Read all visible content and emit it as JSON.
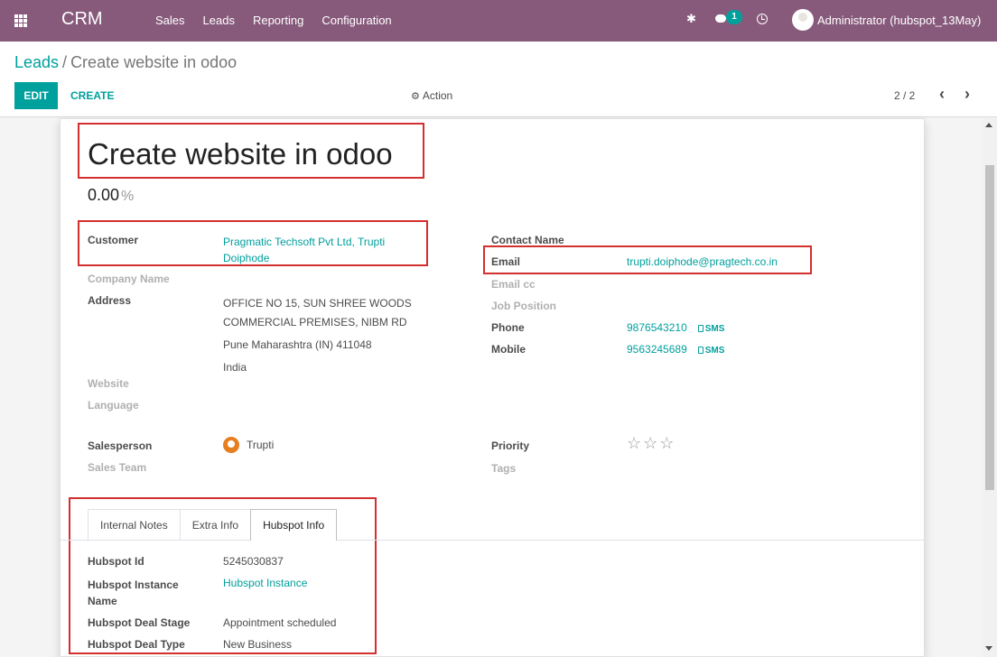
{
  "navbar": {
    "brand": "CRM",
    "menu": [
      "Sales",
      "Leads",
      "Reporting",
      "Configuration"
    ],
    "chat_count": "1",
    "user": "Administrator (hubspot_13May)"
  },
  "control": {
    "breadcrumb_parent": "Leads",
    "breadcrumb_sep": "/",
    "breadcrumb_current": "Create website in odoo",
    "edit_label": "EDIT",
    "create_label": "CREATE",
    "action_label": "Action",
    "pager": "2 / 2",
    "prev": "‹",
    "next": "›"
  },
  "lead": {
    "title": "Create website in odoo",
    "probability": "0.00",
    "probability_unit": "%",
    "left": {
      "customer_label": "Customer",
      "customer_line1": "Pragmatic Techsoft Pvt Ltd, Trupti",
      "customer_line2": "Doiphode",
      "company_label": "Company Name",
      "address_label": "Address",
      "address_line1": "OFFICE NO 15, SUN SHREE WOODS",
      "address_line2": "COMMERCIAL PREMISES, NIBM RD",
      "address_line3": "Pune  Maharashtra (IN)  411048",
      "address_line4": "India",
      "website_label": "Website",
      "language_label": "Language",
      "salesperson_label": "Salesperson",
      "salesperson": "Trupti",
      "team_label": "Sales Team"
    },
    "right": {
      "contact_label": "Contact Name",
      "email_label": "Email",
      "email": "trupti.doiphode@pragtech.co.in",
      "emailcc_label": "Email cc",
      "job_label": "Job Position",
      "phone_label": "Phone",
      "phone": "9876543210",
      "mobile_label": "Mobile",
      "mobile": "9563245689",
      "sms_label": "SMS",
      "priority_label": "Priority",
      "priority_stars": "☆☆☆",
      "priority_value": 0,
      "tags_label": "Tags"
    },
    "tabs": [
      "Internal Notes",
      "Extra Info",
      "Hubspot Info"
    ],
    "hubspot": {
      "id_label": "Hubspot Id",
      "id": "5245030837",
      "instance_label_1": "Hubspot Instance",
      "instance_label_2": "Name",
      "instance": "Hubspot Instance",
      "stage_label": "Hubspot Deal Stage",
      "stage": "Appointment scheduled",
      "type_label": "Hubspot Deal Type",
      "type": "New Business"
    }
  },
  "colors": {
    "navbar": "#875a7b",
    "accent": "#00a09d",
    "highlight_box": "#d32f2f"
  }
}
